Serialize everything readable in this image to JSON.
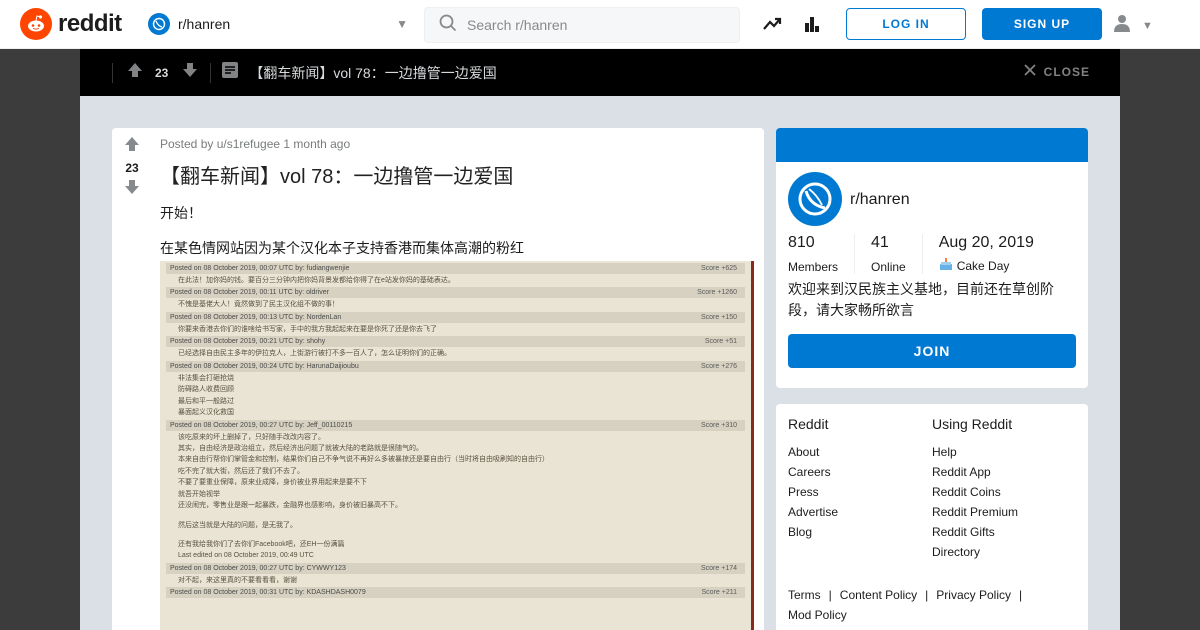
{
  "header": {
    "logo_text": "reddit",
    "community": "r/hanren",
    "search_placeholder": "Search r/hanren",
    "login_label": "LOG IN",
    "signup_label": "SIGN UP"
  },
  "postbar": {
    "score": "23",
    "title": "【翻车新闻】vol 78：一边撸管一边爱国",
    "close_label": "CLOSE"
  },
  "post": {
    "score": "23",
    "meta": "Posted by u/s1refugee 1 month ago",
    "title": "【翻车新闻】vol 78：一边撸管一边爱国",
    "para1": "开始！",
    "para2": "在某色情网站因为某个汉化本子支持香港而集体高潮的粉红",
    "forum": {
      "posts": [
        {
          "header": "Posted on 08 October 2019, 00:07 UTC by: fudiangwenjie",
          "score": "Score +625",
          "body": [
            "在此法！加你妈的钱。要百分三分钟内把你妈背景发都给你得了在e站发你妈的基础表达。"
          ]
        },
        {
          "header": "Posted on 08 October 2019, 00:11 UTC by: oldriver",
          "score": "Score +1260",
          "body": [
            "不愧是基佬大人！竟然做到了民主汉化组不做的事！"
          ]
        },
        {
          "header": "Posted on 08 October 2019, 00:13 UTC by: NordenLan",
          "score": "Score +150",
          "body": [
            "你要来香港去你们的谁啥给书写家，手中的我方我起起来在要是你死了还是你去飞了"
          ]
        },
        {
          "header": "Posted on 08 October 2019, 00:21 UTC by: shohy",
          "score": "Score +51",
          "body": [
            "已经选择自由民主多年的伊拉克人，上街游行被打不多一百人了，怎么证明你们的正确。"
          ]
        },
        {
          "header": "Posted on 08 October 2019, 00:24 UTC by: HarunaDaijioubu",
          "score": "Score +276",
          "body": [
            "非法集会打砸抢烧",
            "防碍路人收费回顾",
            "最后和平一般路过",
            "暴面起义汉化救国"
          ]
        },
        {
          "header": "Posted on 08 October 2019, 00:27 UTC by: Jeff_00110215",
          "score": "Score +310",
          "body": [
            "该吃原来的坏上删掉了，只好随手改改内容了。",
            "其实，自由经济是政治组立，然后经济出问题了就被大陆的老路就是很随气的。",
            "本来自由行帮你们掌管金和控制，结果你们自己不争气说不再好么多被暴掠还是要自由行（当时将自由吸刷知的自由行）",
            "吃不完了就大街，然后还了我们不去了。",
            "不要了要重业保障，原来业成降，身价被业界用起来是要不下",
            "就吾开始视举",
            "还没闹完，零售业是跟一起暴跌，金融界也感影响，身价被旧暴高不下。",
            "",
            "然后这当就是大陆的问题，是无我了。",
            "",
            "还有我给我你们了去你们Facebook吧，还EH一份满篇",
            "Last edited on 08 October 2019, 00:49 UTC"
          ]
        },
        {
          "header": "Posted on 08 October 2019, 00:27 UTC by: CYWWY123",
          "score": "Score +174",
          "body": [
            "对不起，来这里真的不要看看看，谢谢"
          ]
        },
        {
          "header": "Posted on 08 October 2019, 00:31 UTC by: KDASHDASH0079",
          "score": "Score +211",
          "body": []
        }
      ]
    }
  },
  "about": {
    "community": "r/hanren",
    "members_value": "810",
    "members_label": "Members",
    "online_value": "41",
    "online_label": "Online",
    "cake_value": "Aug 20, 2019",
    "cake_label": "Cake Day",
    "description": "欢迎来到汉民族主义基地，目前还在草创阶段，请大家畅所欲言",
    "join_label": "JOIN"
  },
  "links": {
    "col1_title": "Reddit",
    "col1": [
      "About",
      "Careers",
      "Press",
      "Advertise",
      "Blog"
    ],
    "col2_title": "Using Reddit",
    "col2": [
      "Help",
      "Reddit App",
      "Reddit Coins",
      "Reddit Premium",
      "Reddit Gifts",
      "Directory"
    ],
    "legal": [
      "Terms",
      "Content Policy",
      "Privacy Policy",
      "Mod Policy"
    ]
  },
  "colors": {
    "brand": "#ff4500",
    "accent": "#0079d3"
  }
}
